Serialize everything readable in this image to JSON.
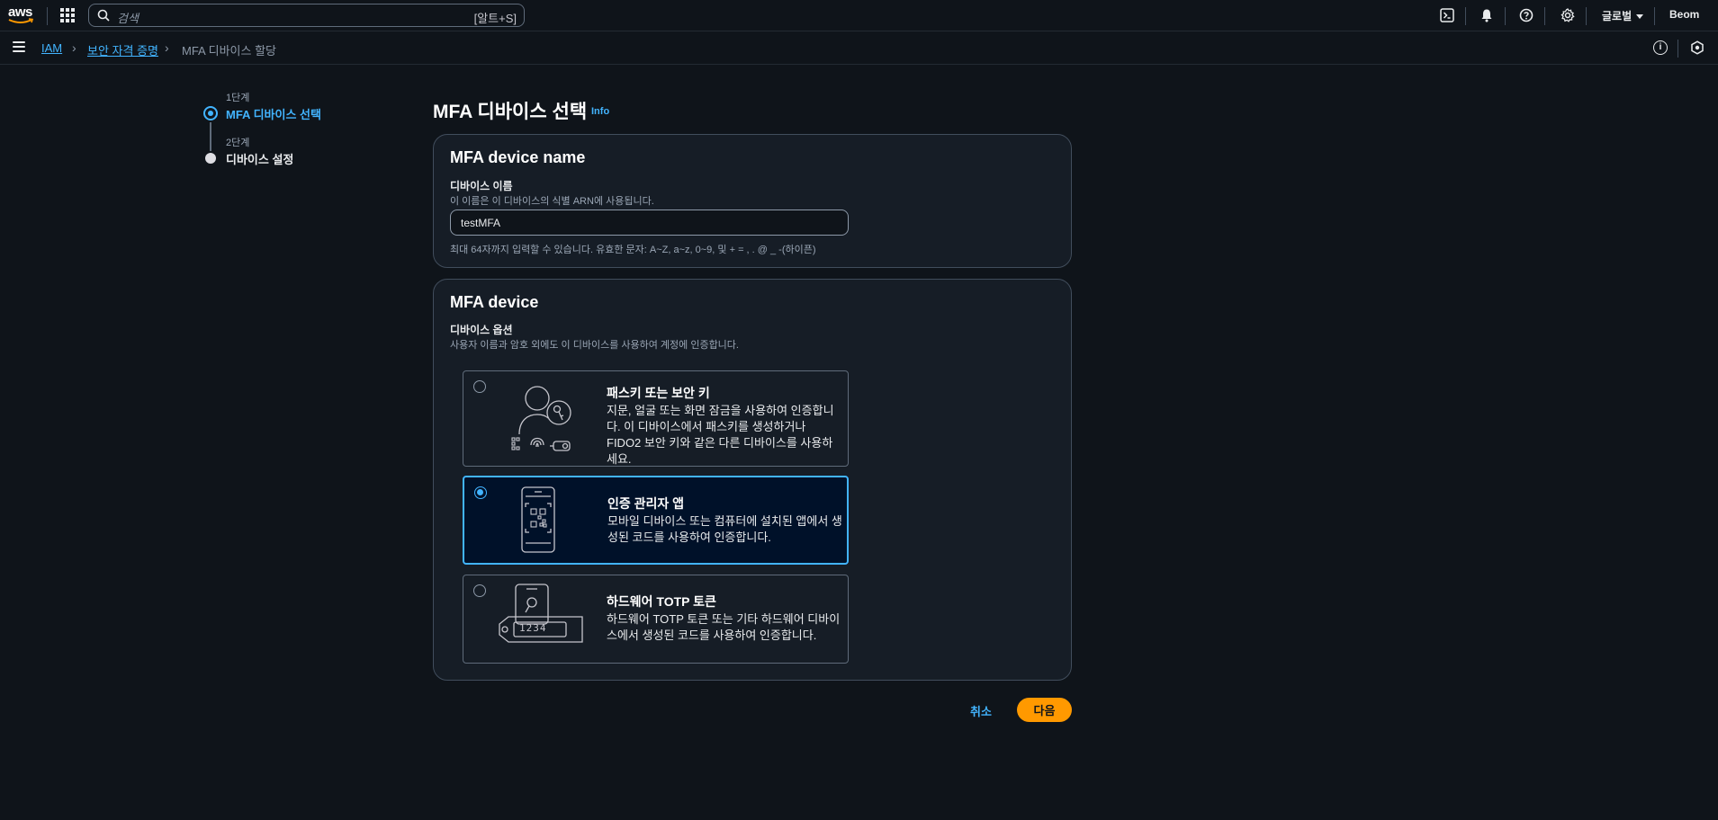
{
  "topnav": {
    "logo_text": "aws",
    "search_placeholder": "검색",
    "search_shortcut": "[알트+S]",
    "region": "글로벌",
    "account": "Beom"
  },
  "breadcrumb": {
    "items": [
      "IAM",
      "보안 자격 증명",
      "MFA 디바이스 할당"
    ]
  },
  "steps": [
    {
      "number": "1단계",
      "label": "MFA 디바이스 선택",
      "state": "active"
    },
    {
      "number": "2단계",
      "label": "디바이스 설정",
      "state": "pending"
    }
  ],
  "page": {
    "title": "MFA 디바이스 선택",
    "info": "Info"
  },
  "name_section": {
    "title": "MFA device name",
    "label": "디바이스 이름",
    "description": "이 이름은 이 디바이스의 식별 ARN에 사용됩니다.",
    "value": "testMFA",
    "constraint": "최대 64자까지 입력할 수 있습니다. 유효한 문자: A~Z, a~z, 0~9, 및 + = , . @ _ -(하이픈)"
  },
  "device_section": {
    "title": "MFA device",
    "label": "디바이스 옵션",
    "description": "사용자 이름과 암호 외에도 이 디바이스를 사용하여 계정에 인증합니다.",
    "options": [
      {
        "title": "패스키 또는 보안 키",
        "description": "지문, 얼굴 또는 화면 잠금을 사용하여 인증합니다. 이 디바이스에서 패스키를 생성하거나 FIDO2 보안 키와 같은 다른 디바이스를 사용하세요.",
        "selected": false
      },
      {
        "title": "인증 관리자 앱",
        "description": "모바일 디바이스 또는 컴퓨터에 설치된 앱에서 생성된 코드를 사용하여 인증합니다.",
        "selected": true
      },
      {
        "title": "하드웨어 TOTP 토큰",
        "description": "하드웨어 TOTP 토큰 또는 기타 하드웨어 디바이스에서 생성된 코드를 사용하여 인증합니다.",
        "selected": false,
        "token_display": "1234"
      }
    ]
  },
  "actions": {
    "cancel": "취소",
    "next": "다음"
  },
  "colors": {
    "background": "#0f141a",
    "container": "#161d26",
    "link": "#42b4ff",
    "primary_button": "#ff9900"
  }
}
